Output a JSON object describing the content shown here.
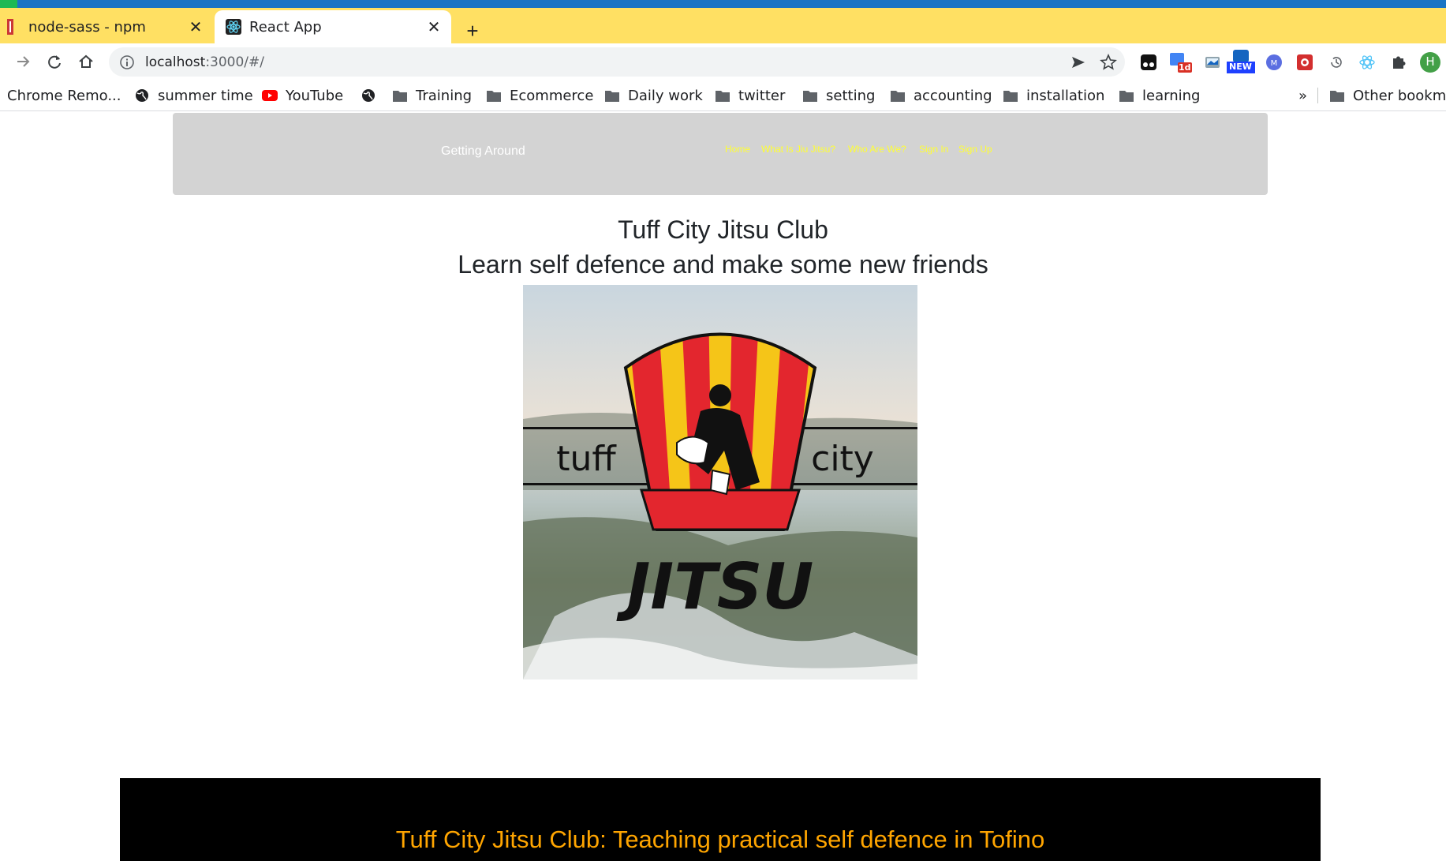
{
  "browser": {
    "tabs": [
      {
        "title": "node-sass - npm",
        "active": false,
        "icon": "npm-icon"
      },
      {
        "title": "React App",
        "active": true,
        "icon": "react-icon"
      }
    ],
    "new_tab_label": "+",
    "close_glyph": "✕",
    "address": {
      "host": "localhost",
      "path": ":3000/#/"
    },
    "bookmarks": [
      {
        "label": "Chrome Remo...",
        "icon": "none"
      },
      {
        "label": "summer time",
        "icon": "globe-icon"
      },
      {
        "label": "YouTube",
        "icon": "youtube-icon"
      },
      {
        "label": "",
        "icon": "globe-icon"
      },
      {
        "label": "Training",
        "icon": "folder-icon"
      },
      {
        "label": "Ecommerce",
        "icon": "folder-icon"
      },
      {
        "label": "Daily work",
        "icon": "folder-icon"
      },
      {
        "label": "twitter",
        "icon": "folder-icon"
      },
      {
        "label": "setting",
        "icon": "folder-icon"
      },
      {
        "label": "accounting",
        "icon": "folder-icon"
      },
      {
        "label": "installation",
        "icon": "folder-icon"
      },
      {
        "label": "learning",
        "icon": "folder-icon"
      }
    ],
    "bookmarks_overflow": "»",
    "other_bookmarks": "Other bookmarks",
    "profile_initial": "H",
    "extension_badges": {
      "calendar": "1d",
      "new": "NEW"
    },
    "colors": {
      "tabbar": "#ffe063",
      "window_strip": "#1a74c4",
      "profile": "#43a047"
    }
  },
  "site": {
    "brand": "Getting Around",
    "nav": [
      "Home",
      "What Is Jiu Jitsu?",
      "Who Are We?",
      "Sign In",
      "Sign Up"
    ],
    "title": "Tuff City Jitsu Club",
    "subtitle": "Learn self defence and make some new friends",
    "logo": {
      "left_word": "tuff",
      "right_word": "city",
      "bottom_word": "JITSU"
    },
    "footer": "Tuff City Jitsu Club: Teaching practical self defence in Tofino",
    "colors": {
      "header_bg": "#d3d3d3",
      "nav_link": "#ffff33",
      "footer_bg": "#000000",
      "footer_text": "#ffa500"
    }
  }
}
